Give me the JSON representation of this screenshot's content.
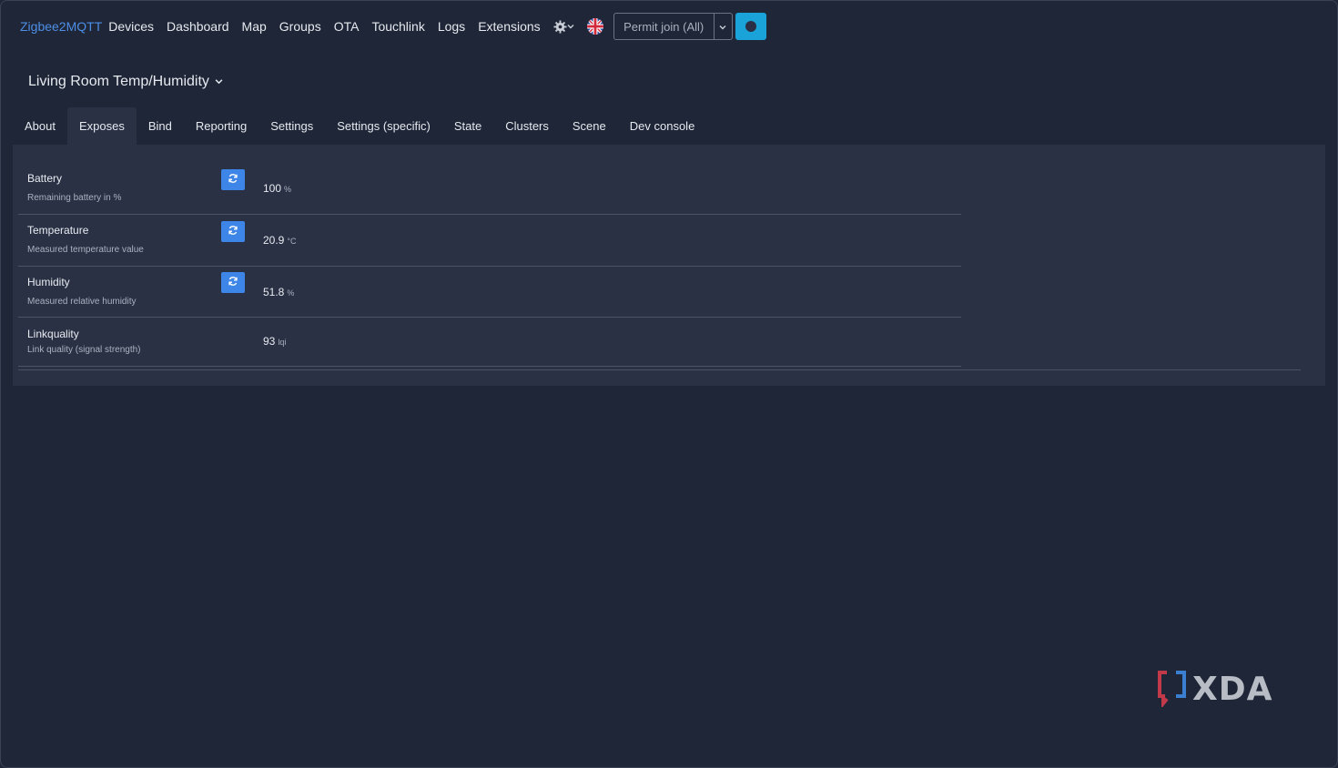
{
  "navbar": {
    "brand": "Zigbee2MQTT",
    "links": [
      "Devices",
      "Dashboard",
      "Map",
      "Groups",
      "OTA",
      "Touchlink",
      "Logs",
      "Extensions"
    ],
    "settings_icon": "gear-icon",
    "language_icon": "uk-flag-icon",
    "permit_join_label": "Permit join (All)",
    "status_icon": "circle-icon"
  },
  "device": {
    "title": "Living Room Temp/Humidity"
  },
  "tabs": [
    "About",
    "Exposes",
    "Bind",
    "Reporting",
    "Settings",
    "Settings (specific)",
    "State",
    "Clusters",
    "Scene",
    "Dev console"
  ],
  "active_tab": "Exposes",
  "exposes": [
    {
      "label": "Battery",
      "description": "Remaining battery in %",
      "value": "100",
      "unit": "%",
      "refreshable": true
    },
    {
      "label": "Temperature",
      "description": "Measured temperature value",
      "value": "20.9",
      "unit": "°C",
      "refreshable": true
    },
    {
      "label": "Humidity",
      "description": "Measured relative humidity",
      "value": "51.8",
      "unit": "%",
      "refreshable": true
    },
    {
      "label": "Linkquality",
      "description": "Link quality (signal strength)",
      "value": "93",
      "unit": "lqi",
      "refreshable": false
    }
  ],
  "watermark": {
    "text": "XDA"
  },
  "colors": {
    "background": "#1f2637",
    "panel": "#2a3145",
    "brand": "#4d8fe6",
    "refresh_button": "#3d86e8",
    "status_button": "#1aa3d8"
  }
}
